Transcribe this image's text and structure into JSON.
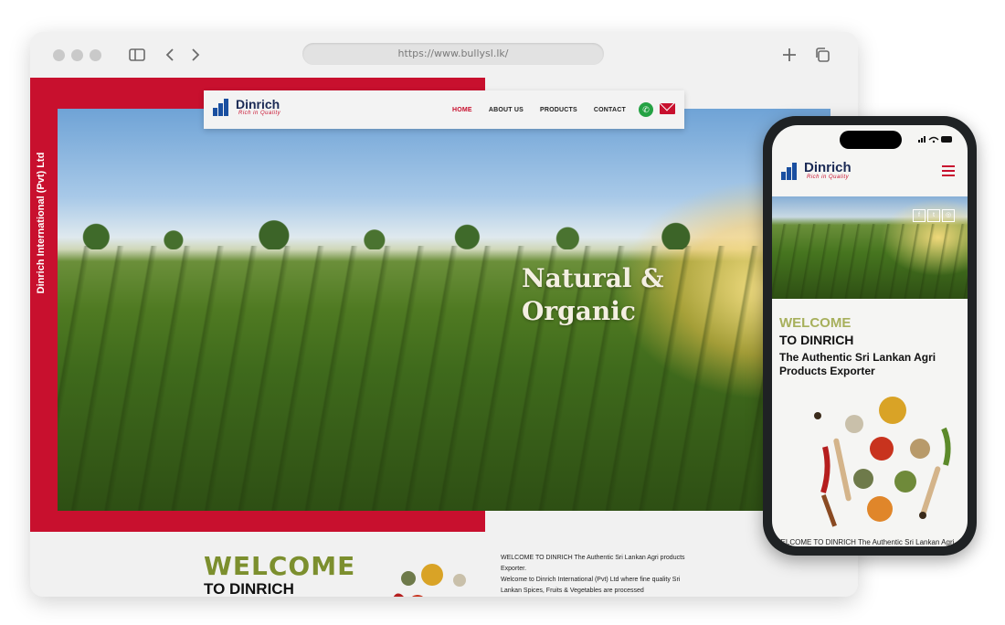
{
  "browser": {
    "url": "https://www.bullysl.lk/"
  },
  "site": {
    "brand": "Dinrich",
    "tagline": "Rich in Quality",
    "vertical_text": "Dinrich International (Pvt) Ltd",
    "nav": [
      {
        "label": "HOME",
        "active": true
      },
      {
        "label": "ABOUT US",
        "active": false
      },
      {
        "label": "PRODUCTS",
        "active": false
      },
      {
        "label": "CONTACT",
        "active": false
      }
    ],
    "hero_line1": "Natural &",
    "hero_line2": "Organic",
    "welcome_title": "WELCOME",
    "welcome_sub": "TO DINRICH",
    "welcome_body_1": "WELCOME TO DINRICH The Authentic Sri Lankan Agri products Exporter.",
    "welcome_body_2": "Welcome to Dinrich International (Pvt) Ltd where fine quality Sri Lankan Spices, Fruits & Vegetables are processed"
  },
  "mobile": {
    "welcome": "WELCOME",
    "to": "TO DINRICH",
    "authentic": "The Authentic Sri Lankan Agri Products Exporter",
    "footer_text": "WELCOME TO DINRICH The Authentic Sri Lankan Agri"
  },
  "colors": {
    "brand_red": "#c8102e",
    "brand_blue": "#1a4fa0",
    "olive": "#7c8f2e"
  },
  "icons": [
    "sidebar-icon",
    "back-icon",
    "forward-icon",
    "plus-icon",
    "tabs-icon",
    "whatsapp-icon",
    "mail-icon",
    "menu-icon",
    "facebook-icon",
    "twitter-icon",
    "instagram-icon"
  ]
}
